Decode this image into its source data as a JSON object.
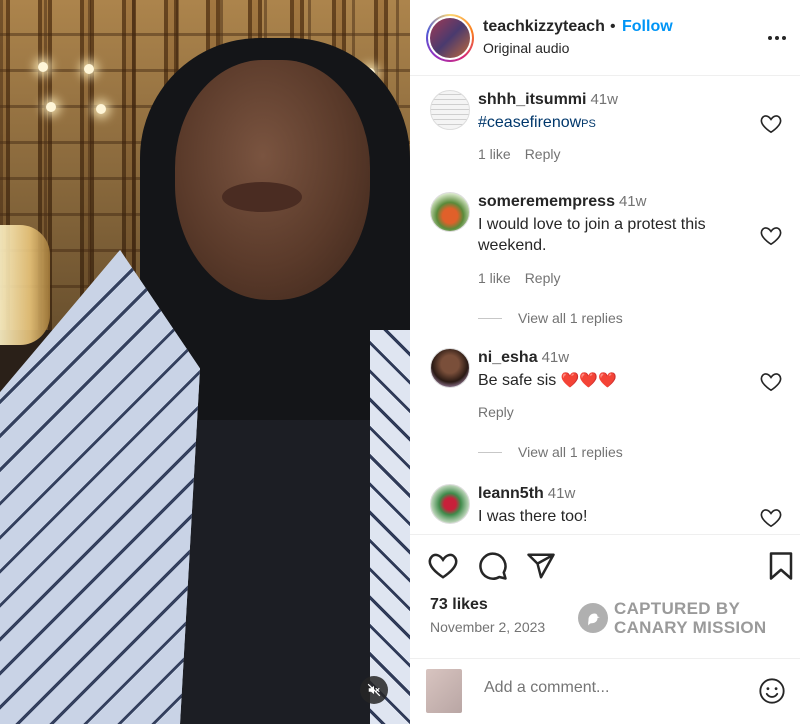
{
  "post": {
    "username": "teachkizzyteach",
    "separator": "•",
    "follow_label": "Follow",
    "audio_label": "Original audio",
    "more_icon": "more-options-icon"
  },
  "comments": [
    {
      "username": "shhh_itsummi",
      "time": "41w",
      "text": "#ceasefirenow",
      "text_suffix": "PS",
      "likes": "1 like",
      "reply": "Reply"
    },
    {
      "username": "someremempress",
      "time": "41w",
      "text": "I would love to join a protest this weekend.",
      "likes": "1 like",
      "reply": "Reply",
      "view_replies": "View all 1 replies"
    },
    {
      "username": "ni_esha",
      "time": "41w",
      "text": "Be safe sis",
      "hearts": "❤️❤️❤️",
      "reply": "Reply",
      "view_replies": "View all 1 replies"
    },
    {
      "username": "leann5th",
      "time": "41w",
      "text": "I was there too!"
    }
  ],
  "footer": {
    "likes": "73 likes",
    "date": "November 2, 2023",
    "add_comment_placeholder": "Add a comment...",
    "watermark_line1": "CAPTURED BY",
    "watermark_line2": "CANARY MISSION"
  },
  "colors": {
    "follow_blue": "#0095f6",
    "hashtag": "#00376b",
    "muted_text": "#737373"
  }
}
